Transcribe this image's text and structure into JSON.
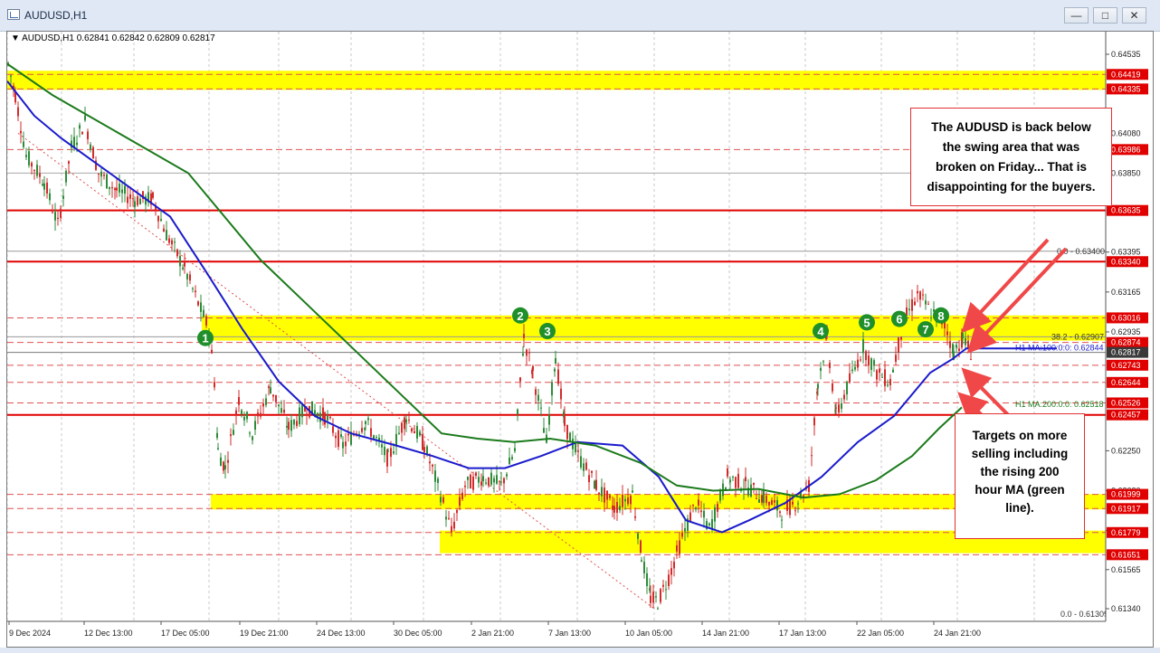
{
  "window": {
    "title": "AUDUSD,H1"
  },
  "chart_header": {
    "symbol_line": "AUDUSD,H1  0.62841 0.62842 0.62809 0.62817"
  },
  "price_ticks": [
    "0.64535",
    "0.64080",
    "0.63850",
    "0.63395",
    "0.63165",
    "0.62935",
    "0.62250",
    "0.62020",
    "0.61790",
    "0.61565",
    "0.61340"
  ],
  "level_labels": [
    {
      "value": "0.64419",
      "kind": "red"
    },
    {
      "value": "0.64335",
      "kind": "red"
    },
    {
      "value": "0.63986",
      "kind": "red"
    },
    {
      "value": "0.63635",
      "kind": "red"
    },
    {
      "value": "0.63340",
      "kind": "red"
    },
    {
      "value": "0.63016",
      "kind": "red"
    },
    {
      "value": "0.62874",
      "kind": "red"
    },
    {
      "value": "0.62817",
      "kind": "dark"
    },
    {
      "value": "0.62743",
      "kind": "red"
    },
    {
      "value": "0.62644",
      "kind": "red"
    },
    {
      "value": "0.62526",
      "kind": "red"
    },
    {
      "value": "0.62457",
      "kind": "red"
    },
    {
      "value": "0.61999",
      "kind": "red"
    },
    {
      "value": "0.61917",
      "kind": "red"
    },
    {
      "value": "0.61779",
      "kind": "red"
    },
    {
      "value": "0.61651",
      "kind": "red"
    }
  ],
  "fib_labels": {
    "top": "0.0 - 0.63400",
    "mid": "38.2 - 0.62907",
    "bottom": "0.0 - 0.61309"
  },
  "ma_labels": {
    "ma100": "H1 MA:100:0:0: 0.62844",
    "ma200": "H1 MA:200:0:0: 0.62518"
  },
  "time_ticks": [
    "9 Dec 2024",
    "12 Dec 13:00",
    "17 Dec 05:00",
    "19 Dec 21:00",
    "24 Dec 13:00",
    "30 Dec 05:00",
    "2 Jan 21:00",
    "7 Jan 13:00",
    "10 Jan 05:00",
    "14 Jan 21:00",
    "17 Jan 13:00",
    "22 Jan 05:00",
    "24 Jan 21:00"
  ],
  "markers": [
    "1",
    "2",
    "3",
    "4",
    "5",
    "6",
    "7",
    "8"
  ],
  "annotations": {
    "top": [
      "The AUDUSD is back below",
      "the swing area that was",
      "broken on Friday... That is",
      "disappointing for the buyers."
    ],
    "bottom": [
      "Targets on more",
      "selling including",
      "the rising 200",
      "hour MA (green",
      "line)."
    ]
  },
  "colors": {
    "yellow_zone": "#ffff00",
    "red_line": "#e00000",
    "ma100": "#1a1acc",
    "ma200": "#1b7a1b",
    "marker": "#1f8f2b",
    "up_candle": "#2e8b3a",
    "down_candle": "#d22b2b",
    "arrow": "#f04848"
  },
  "icons": [
    "app-chart-icon",
    "minimize-icon",
    "maximize-icon",
    "close-icon",
    "dropdown-triangle-icon"
  ]
}
